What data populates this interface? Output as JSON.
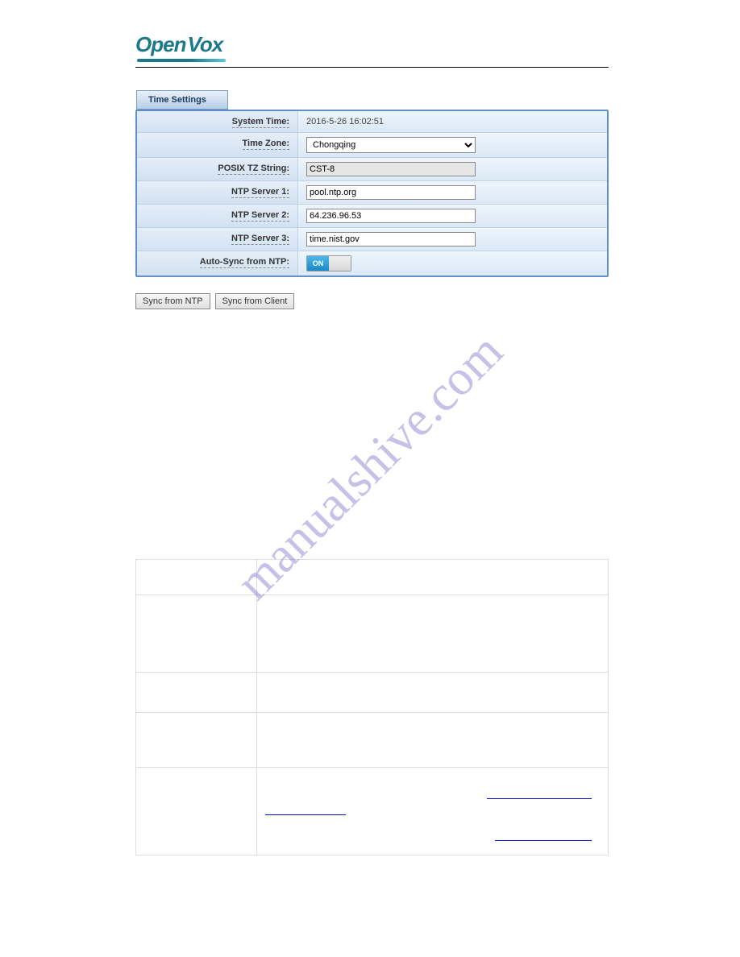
{
  "logo": {
    "part1": "Open",
    "part2": "Vox"
  },
  "watermark": "manualshive.com",
  "tab": {
    "title": "Time Settings"
  },
  "settings": {
    "system_time": {
      "label": "System Time:",
      "value": "2016-5-26 16:02:51"
    },
    "time_zone": {
      "label": "Time Zone:",
      "value": "Chongqing"
    },
    "posix_tz": {
      "label": "POSIX TZ String:",
      "value": "CST-8"
    },
    "ntp1": {
      "label": "NTP Server 1:",
      "value": "pool.ntp.org"
    },
    "ntp2": {
      "label": "NTP Server 2:",
      "value": "64.236.96.53"
    },
    "ntp3": {
      "label": "NTP Server 3:",
      "value": "time.nist.gov"
    },
    "autosync": {
      "label": "Auto-Sync from NTP:",
      "state": "ON"
    }
  },
  "buttons": {
    "sync_ntp": "Sync from NTP",
    "sync_client": "Sync from Client"
  }
}
